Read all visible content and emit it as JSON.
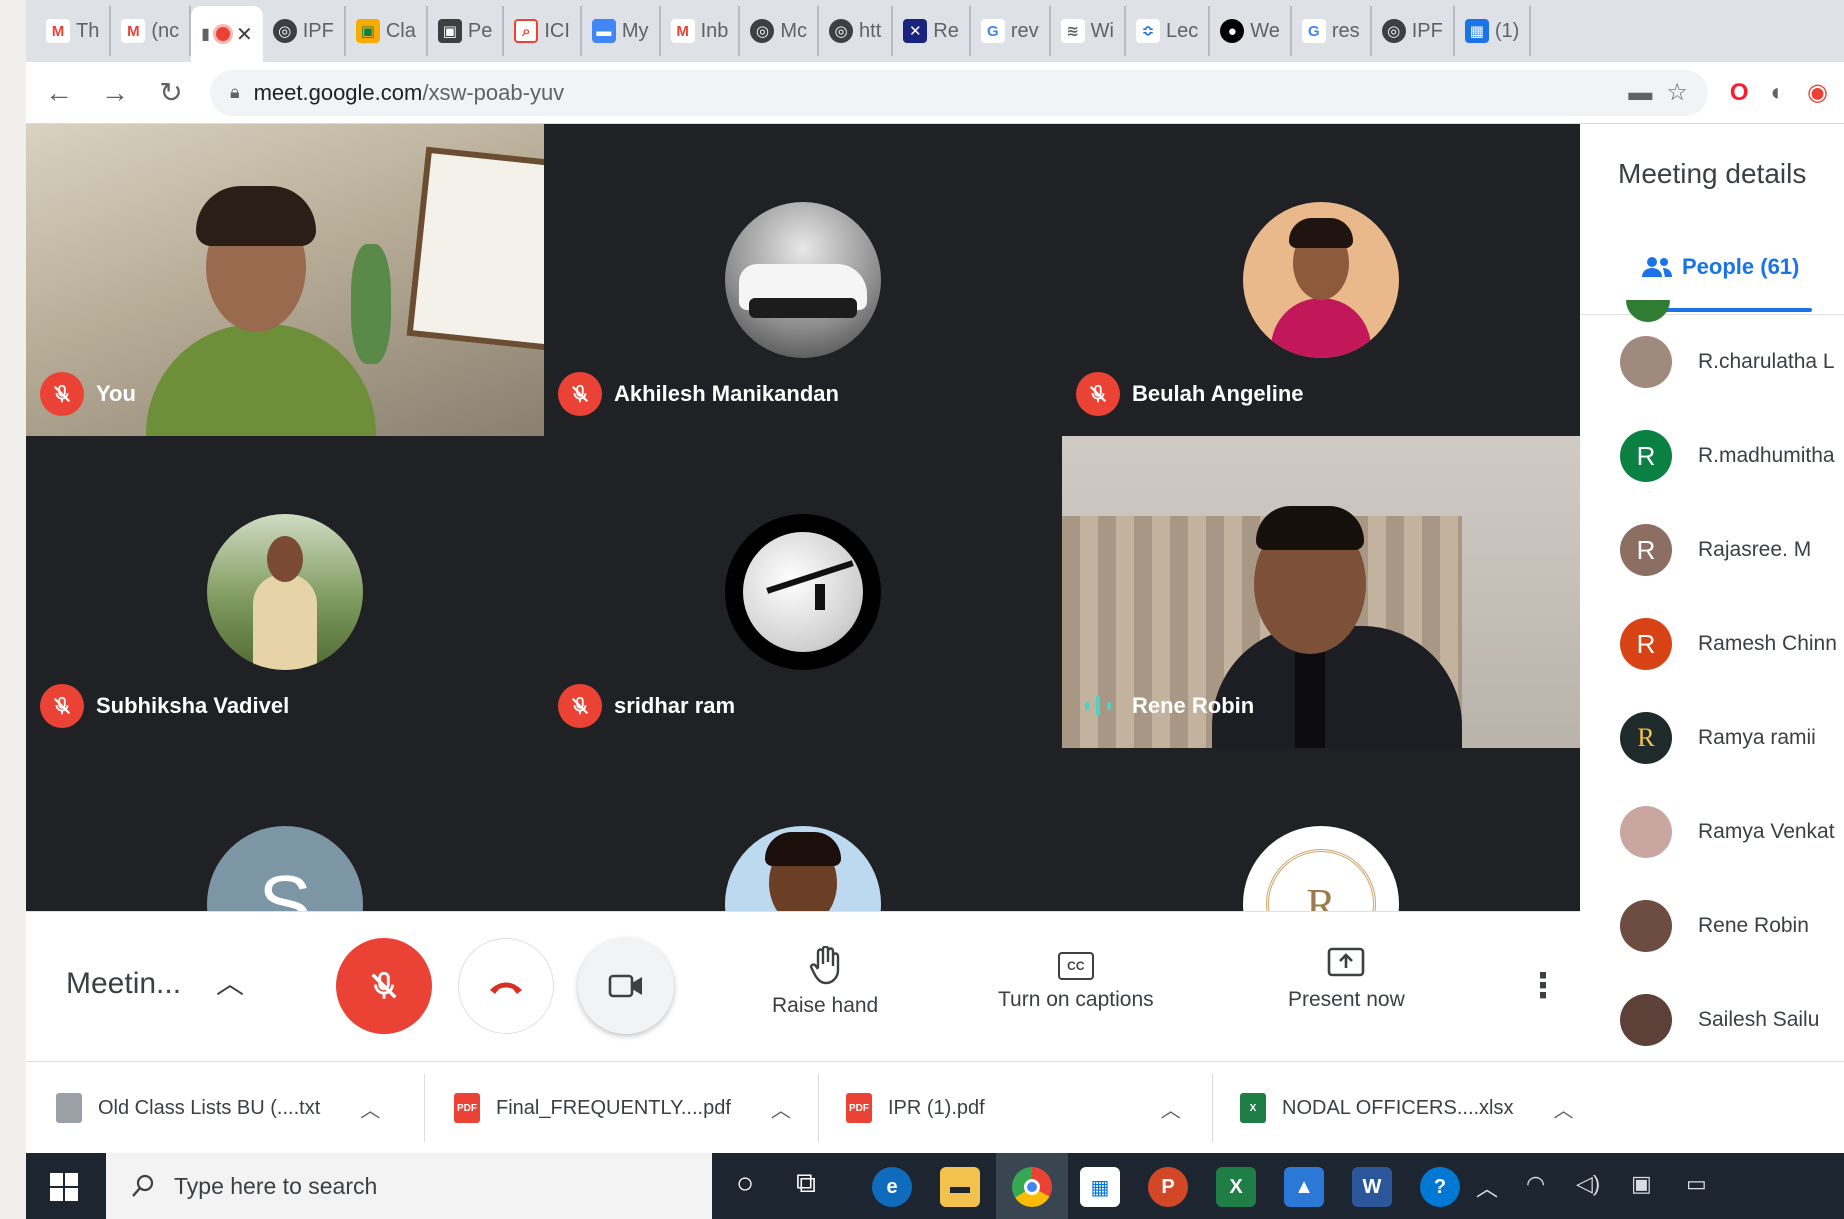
{
  "browser": {
    "tabs": [
      {
        "label": "Th",
        "icon": "gmail-icon"
      },
      {
        "label": "(nc",
        "icon": "gmail-icon"
      },
      {
        "label": "",
        "icon": "meet-recording-icon",
        "active": true,
        "close": "✕"
      },
      {
        "label": "IPF",
        "icon": "globe-icon"
      },
      {
        "label": "Cla",
        "icon": "classroom-icon"
      },
      {
        "label": "Pe",
        "icon": "contacts-icon"
      },
      {
        "label": "ICI",
        "icon": "search-icon"
      },
      {
        "label": "My",
        "icon": "link-icon"
      },
      {
        "label": "Inb",
        "icon": "gmail-icon"
      },
      {
        "label": "Mc",
        "icon": "globe-icon"
      },
      {
        "label": "htt",
        "icon": "globe-icon"
      },
      {
        "label": "Re",
        "icon": "app-icon"
      },
      {
        "label": "rev",
        "icon": "google-icon"
      },
      {
        "label": "Wi",
        "icon": "wifi-icon"
      },
      {
        "label": "Lec",
        "icon": "bookmark-icon"
      },
      {
        "label": "We",
        "icon": "app-icon"
      },
      {
        "label": "res",
        "icon": "google-icon"
      },
      {
        "label": "IPF",
        "icon": "globe-icon"
      },
      {
        "label": "(1)",
        "icon": "calendar-icon"
      }
    ],
    "url_host": "meet.google.com",
    "url_path": "/xsw-poab-yuv"
  },
  "grid": {
    "tiles": [
      {
        "name": "You",
        "kind": "video",
        "muted": true
      },
      {
        "name": "Akhilesh Manikandan",
        "kind": "avatar",
        "muted": true
      },
      {
        "name": "Beulah Angeline",
        "kind": "avatar",
        "muted": true
      },
      {
        "name": "Subhiksha Vadivel",
        "kind": "avatar",
        "muted": true
      },
      {
        "name": "sridhar ram",
        "kind": "avatar",
        "muted": true
      },
      {
        "name": "Rene Robin",
        "kind": "video",
        "speaking": true
      },
      {
        "name": "",
        "kind": "avatar",
        "initial": "S"
      },
      {
        "name": "",
        "kind": "avatar"
      },
      {
        "name": "",
        "kind": "avatar",
        "initial": "R"
      }
    ]
  },
  "meetbar": {
    "title": "Meetin...",
    "raise_hand": "Raise hand",
    "captions": "Turn on captions",
    "present": "Present now",
    "captions_badge": "CC"
  },
  "panel": {
    "title": "Meeting details",
    "people_tab": "People (61)",
    "people": [
      {
        "name": "R.charulatha L",
        "initial": "",
        "color": "#8d6e63"
      },
      {
        "name": "R.madhumitha",
        "initial": "R",
        "color": "#0b8043"
      },
      {
        "name": "Rajasree. M",
        "initial": "R",
        "color": "#8d6e63"
      },
      {
        "name": "Ramesh Chinn",
        "initial": "R",
        "color": "#d84315"
      },
      {
        "name": "Ramya ramii",
        "initial": "R",
        "color": "#1f2a2a"
      },
      {
        "name": "Ramya Venkat",
        "initial": "",
        "color": "#c9a7a0"
      },
      {
        "name": "Rene Robin",
        "initial": "",
        "color": "#6d4c41"
      },
      {
        "name": "Sailesh Sailu",
        "initial": "",
        "color": "#5d4037"
      }
    ]
  },
  "downloads": [
    {
      "name": "Old Class Lists BU (....txt",
      "type": "txt"
    },
    {
      "name": "Final_FREQUENTLY....pdf",
      "type": "pdf"
    },
    {
      "name": "IPR (1).pdf",
      "type": "pdf"
    },
    {
      "name": "NODAL OFFICERS....xlsx",
      "type": "xlsx"
    }
  ],
  "taskbar": {
    "search_placeholder": "Type here to search"
  },
  "colors": {
    "mute_red": "#ea4335",
    "accent_blue": "#1a73e8",
    "tile_dark": "#202124"
  }
}
